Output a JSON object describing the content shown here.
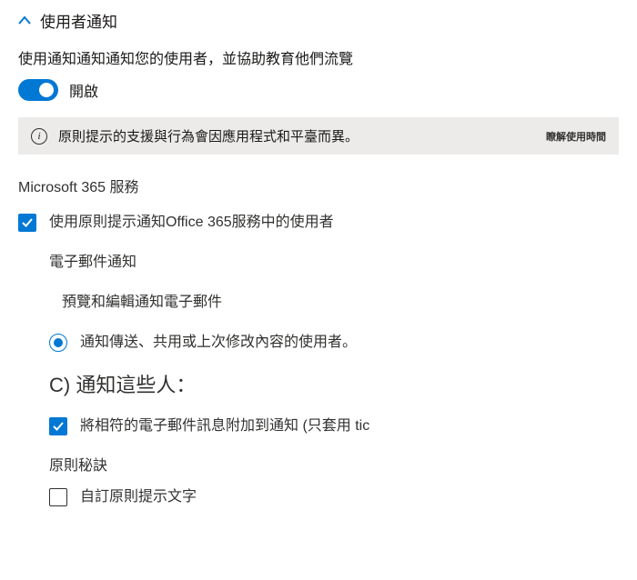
{
  "header": {
    "title": "使用者通知"
  },
  "description": "使用通知通知通知您的使用者，並協助教育他們流覽",
  "toggle": {
    "label": "開啟",
    "on": true
  },
  "infoBanner": {
    "text": "原則提示的支援與行為會因應用程式和平臺而異。",
    "link": "瞭解使用時間"
  },
  "servicesTitle": "Microsoft 365 服務",
  "checkbox1": {
    "label": "使用原則提示通知Office 365服務中的使用者",
    "checked": true
  },
  "emailSection": {
    "title": "電子郵件通知",
    "previewLink": "預覽和編輯通知電子郵件"
  },
  "radio1": {
    "label": "通知傳送、共用或上次修改內容的使用者。",
    "checked": true
  },
  "headingC": "C) 通知這些人：",
  "checkbox2": {
    "label": "將相符的電子郵件訊息附加到通知 (只套用 tic",
    "checked": true
  },
  "tipsTitle": "原則秘訣",
  "checkbox3": {
    "label": "自訂原則提示文字",
    "checked": false
  }
}
